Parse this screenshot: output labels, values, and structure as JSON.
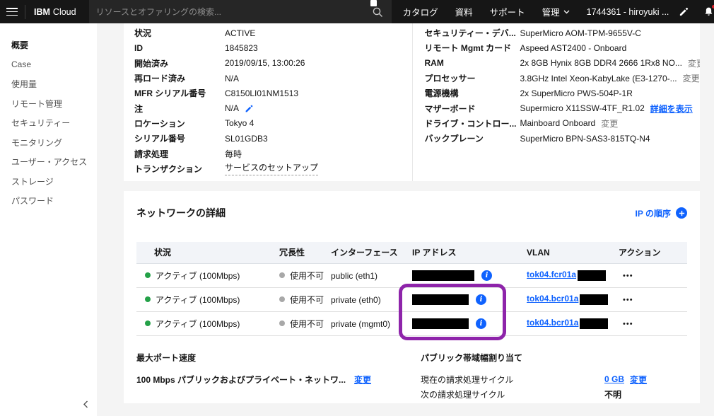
{
  "colors": {
    "accent": "#0f62fe",
    "header-bg": "#161616",
    "green": "#24a148",
    "gray-dot": "#a8a8a8",
    "danger": "#da1e28",
    "purple": "#8e24aa"
  },
  "icons": {
    "menu": "hamburger",
    "search": "magnifier",
    "manage_chevron": "chevron-down",
    "edit": "pencil",
    "notifications": "bell",
    "account": "person",
    "note_edit": "pencil",
    "info": "i-in-circle",
    "add_ip": "plus-in-circle",
    "overflow": "horizontal-ellipsis",
    "collapse": "chevron-left"
  },
  "header": {
    "logo_bold": "IBM",
    "logo_regular": "Cloud",
    "search_placeholder": "リソースとオファリングの検索...",
    "nav": [
      "カタログ",
      "資料",
      "サポート",
      "管理"
    ],
    "account": "1744361 - hiroyuki ..."
  },
  "sidebar": {
    "items": [
      {
        "label": "概要"
      },
      {
        "label": "Case"
      },
      {
        "label": "使用量"
      },
      {
        "label": "リモート管理"
      },
      {
        "label": "セキュリティー"
      },
      {
        "label": "モニタリング"
      },
      {
        "label": "ユーザー・アクセス"
      },
      {
        "label": "ストレージ"
      },
      {
        "label": "パスワード"
      }
    ]
  },
  "details_left": [
    {
      "label": "状況",
      "value": "ACTIVE"
    },
    {
      "label": "ID",
      "value": "1845823"
    },
    {
      "label": "開始済み",
      "value": "2019/09/15, 13:00:26"
    },
    {
      "label": "再ロード済み",
      "value": "N/A"
    },
    {
      "label": "MFR シリアル番号",
      "value": "C8150LI01NM1513"
    },
    {
      "label": "注",
      "value": "N/A"
    },
    {
      "label": "ロケーション",
      "value": "Tokyo 4"
    },
    {
      "label": "シリアル番号",
      "value": "SL01GDB3"
    },
    {
      "label": "請求処理",
      "value": "毎時"
    },
    {
      "label": "トランザクション",
      "value": "サービスのセットアップ"
    }
  ],
  "details_right": [
    {
      "label": "セキュリティー・デバ...",
      "value": "SuperMicro AOM-TPM-9655V-C"
    },
    {
      "label": "リモート Mgmt カード",
      "value": "Aspeed AST2400 - Onboard"
    },
    {
      "label": "RAM",
      "value": "2x 8GB Hynix 8GB DDR4 2666 1Rx8 NO...",
      "action": "変更"
    },
    {
      "label": "プロセッサー",
      "value": "3.8GHz Intel Xeon-KabyLake (E3-1270-...",
      "action": "変更"
    },
    {
      "label": "電源機構",
      "value": "2x SuperMicro PWS-504P-1R"
    },
    {
      "label": "マザーボード",
      "value": "Supermicro X11SSW-4TF_R1.02",
      "action": "詳細を表示"
    },
    {
      "label": "ドライブ・コントロー...",
      "value": "Mainboard Onboard",
      "action": "変更"
    },
    {
      "label": "バックプレーン",
      "value": "SuperMicro BPN-SAS3-815TQ-N4"
    }
  ],
  "network": {
    "title": "ネットワークの詳細",
    "ip_order_link": "IP の順序",
    "columns": [
      "状況",
      "冗長性",
      "インターフェース",
      "IP アドレス",
      "VLAN",
      "アクション"
    ],
    "rows": [
      {
        "status": "アクティブ (100Mbps)",
        "redundancy": "使用不可",
        "interface": "public (eth1)",
        "vlan": "tok04.fcr01a"
      },
      {
        "status": "アクティブ (100Mbps)",
        "redundancy": "使用不可",
        "interface": "private (eth0)",
        "vlan": "tok04.bcr01a"
      },
      {
        "status": "アクティブ (100Mbps)",
        "redundancy": "使用不可",
        "interface": "private (mgmt0)",
        "vlan": "tok04.bcr01a"
      }
    ]
  },
  "footer": {
    "max_port_title": "最大ポート速度",
    "max_port_value": "100 Mbps パブリックおよびプライベート・ネットワ...",
    "max_port_action": "変更",
    "bandwidth_title": "パブリック帯域幅割り当て",
    "current_cycle_label": "現在の請求処理サイクル",
    "current_cycle_value": "0 GB",
    "current_cycle_action": "変更",
    "next_cycle_label": "次の請求処理サイクル",
    "next_cycle_value": "不明"
  }
}
